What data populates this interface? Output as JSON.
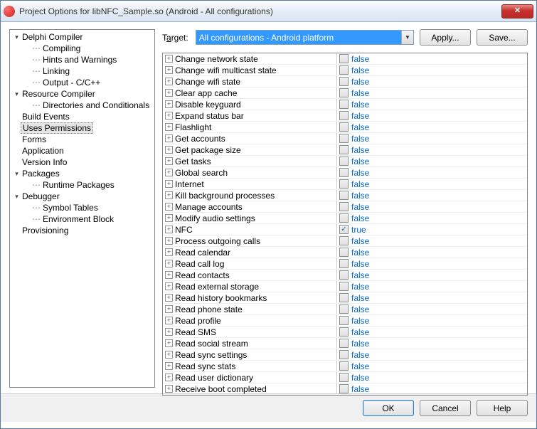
{
  "window": {
    "title": "Project Options for libNFC_Sample.so  (Android - All configurations)"
  },
  "tree": [
    {
      "label": "Delphi Compiler",
      "depth": 0,
      "expand": "▾"
    },
    {
      "label": "Compiling",
      "depth": 1,
      "expand": ""
    },
    {
      "label": "Hints and Warnings",
      "depth": 1,
      "expand": ""
    },
    {
      "label": "Linking",
      "depth": 1,
      "expand": ""
    },
    {
      "label": "Output - C/C++",
      "depth": 1,
      "expand": ""
    },
    {
      "label": "Resource Compiler",
      "depth": 0,
      "expand": "▾"
    },
    {
      "label": "Directories and Conditionals",
      "depth": 1,
      "expand": ""
    },
    {
      "label": "Build Events",
      "depth": 0,
      "expand": ""
    },
    {
      "label": "Uses Permissions",
      "depth": 0,
      "expand": "",
      "selected": true
    },
    {
      "label": "Forms",
      "depth": 0,
      "expand": ""
    },
    {
      "label": "Application",
      "depth": 0,
      "expand": ""
    },
    {
      "label": "Version Info",
      "depth": 0,
      "expand": ""
    },
    {
      "label": "Packages",
      "depth": 0,
      "expand": "▾"
    },
    {
      "label": "Runtime Packages",
      "depth": 1,
      "expand": ""
    },
    {
      "label": "Debugger",
      "depth": 0,
      "expand": "▾"
    },
    {
      "label": "Symbol Tables",
      "depth": 1,
      "expand": ""
    },
    {
      "label": "Environment Block",
      "depth": 1,
      "expand": ""
    },
    {
      "label": "Provisioning",
      "depth": 0,
      "expand": ""
    }
  ],
  "target": {
    "label_pre": "T",
    "label_ul": "a",
    "label_post": "rget:",
    "value": "All configurations - Android platform"
  },
  "buttons": {
    "apply": "Apply...",
    "save": "Save...",
    "ok": "OK",
    "cancel": "Cancel",
    "help": "Help"
  },
  "permissions": [
    {
      "name": "Change network state",
      "value": "false",
      "checked": false
    },
    {
      "name": "Change wifi multicast state",
      "value": "false",
      "checked": false
    },
    {
      "name": "Change wifi state",
      "value": "false",
      "checked": false
    },
    {
      "name": "Clear app cache",
      "value": "false",
      "checked": false
    },
    {
      "name": "Disable keyguard",
      "value": "false",
      "checked": false
    },
    {
      "name": "Expand status bar",
      "value": "false",
      "checked": false
    },
    {
      "name": "Flashlight",
      "value": "false",
      "checked": false
    },
    {
      "name": "Get accounts",
      "value": "false",
      "checked": false
    },
    {
      "name": "Get package size",
      "value": "false",
      "checked": false
    },
    {
      "name": "Get tasks",
      "value": "false",
      "checked": false
    },
    {
      "name": "Global search",
      "value": "false",
      "checked": false
    },
    {
      "name": "Internet",
      "value": "false",
      "checked": false
    },
    {
      "name": "Kill background processes",
      "value": "false",
      "checked": false
    },
    {
      "name": "Manage accounts",
      "value": "false",
      "checked": false
    },
    {
      "name": "Modify audio settings",
      "value": "false",
      "checked": false
    },
    {
      "name": "NFC",
      "value": "true",
      "checked": true
    },
    {
      "name": "Process outgoing calls",
      "value": "false",
      "checked": false
    },
    {
      "name": "Read calendar",
      "value": "false",
      "checked": false
    },
    {
      "name": "Read call log",
      "value": "false",
      "checked": false
    },
    {
      "name": "Read contacts",
      "value": "false",
      "checked": false
    },
    {
      "name": "Read external storage",
      "value": "false",
      "checked": false
    },
    {
      "name": "Read history bookmarks",
      "value": "false",
      "checked": false
    },
    {
      "name": "Read phone state",
      "value": "false",
      "checked": false
    },
    {
      "name": "Read profile",
      "value": "false",
      "checked": false
    },
    {
      "name": "Read SMS",
      "value": "false",
      "checked": false
    },
    {
      "name": "Read social stream",
      "value": "false",
      "checked": false
    },
    {
      "name": "Read sync settings",
      "value": "false",
      "checked": false
    },
    {
      "name": "Read sync stats",
      "value": "false",
      "checked": false
    },
    {
      "name": "Read user dictionary",
      "value": "false",
      "checked": false
    },
    {
      "name": "Receive boot completed",
      "value": "false",
      "checked": false
    }
  ]
}
